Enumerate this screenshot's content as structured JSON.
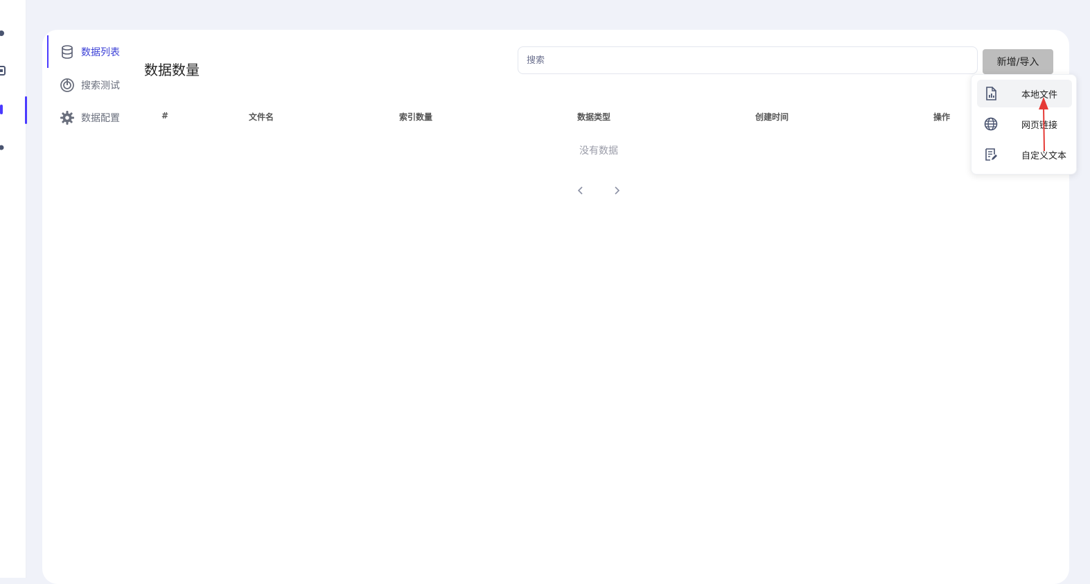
{
  "subnav": {
    "items": [
      {
        "label": "数据列表",
        "icon": "database-icon"
      },
      {
        "label": "搜索测试",
        "icon": "search-test-icon"
      },
      {
        "label": "数据配置",
        "icon": "gear-icon"
      }
    ]
  },
  "page": {
    "title": "数据数量"
  },
  "search": {
    "placeholder": "搜索"
  },
  "toolbar": {
    "add_label": "新增/导入"
  },
  "table": {
    "columns": [
      "#",
      "文件名",
      "索引数量",
      "数据类型",
      "创建时间",
      "操作"
    ],
    "empty_text": "没有数据"
  },
  "dropdown": {
    "items": [
      {
        "label": "本地文件",
        "icon": "file-chart-icon"
      },
      {
        "label": "网页链接",
        "icon": "globe-icon"
      },
      {
        "label": "自定义文本",
        "icon": "edit-doc-icon"
      }
    ]
  },
  "colors": {
    "accent": "#4a3aff",
    "annotation_arrow": "#e53935"
  }
}
